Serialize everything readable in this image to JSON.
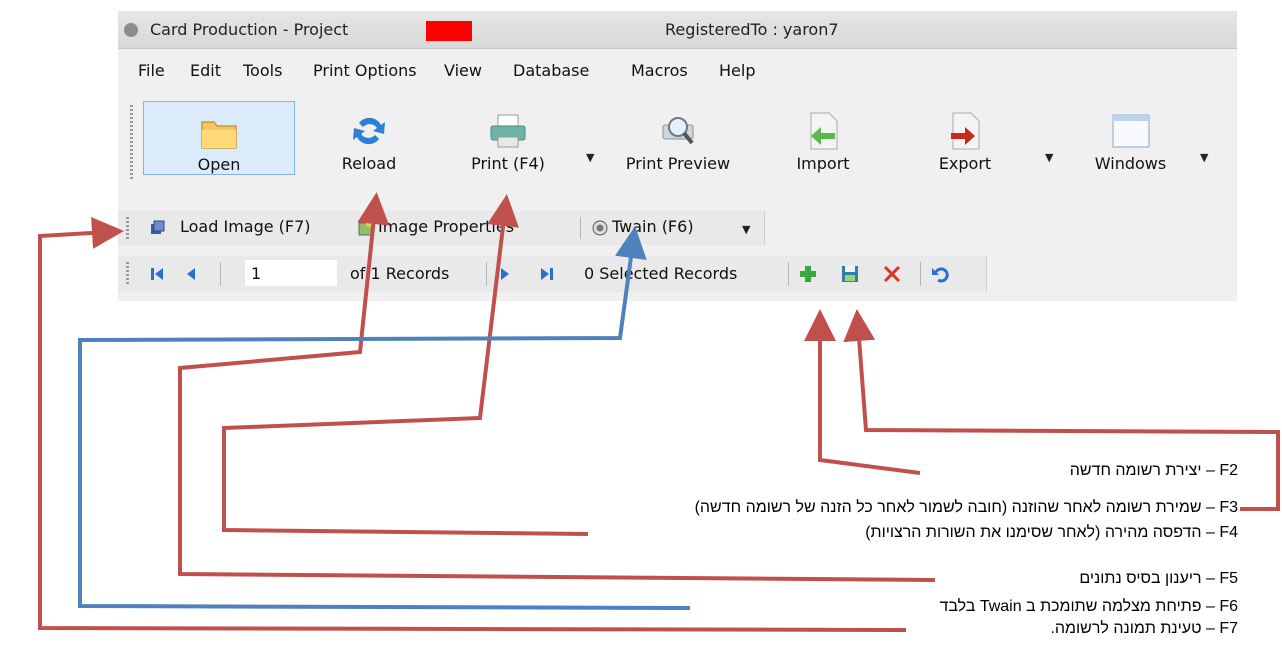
{
  "window": {
    "title": "Card Production - Project",
    "registered": "RegisteredTo : yaron7"
  },
  "menu": [
    "File",
    "Edit",
    "Tools",
    "Print Options",
    "View",
    "Database",
    "Macros",
    "Help"
  ],
  "toolbar": {
    "open": "Open",
    "reload": "Reload",
    "print": "Print (F4)",
    "print_preview": "Print Preview",
    "import": "Import",
    "export": "Export",
    "windows": "Windows"
  },
  "image_toolbar": {
    "load_image": "Load Image (F7)",
    "image_properties": "Image Properties",
    "twain": "Twain (F6)"
  },
  "records": {
    "current": "1",
    "of_records": "of 1 Records",
    "selected": "0 Selected Records"
  },
  "annotations": [
    "F2 – יצירת רשומה חדשה",
    "F3 – שמירת רשומה לאחר שהוזנה (חובה לשמור לאחר כל הזנה של רשומה חדשה)",
    "F4 – הדפסה מהירה (לאחר שסימנו את השורות הרצויות)",
    "F5 – ריענון בסיס נתונים",
    "F6 – פתיחת מצלמה שתומכת ב Twain בלבד",
    "F7 – טעינת תמונה לרשומה."
  ],
  "colors": {
    "arrow_red": "#c0504d",
    "arrow_blue": "#4f81bd",
    "redaction": "#ff0000",
    "selected_bg": "#dcebfc"
  }
}
